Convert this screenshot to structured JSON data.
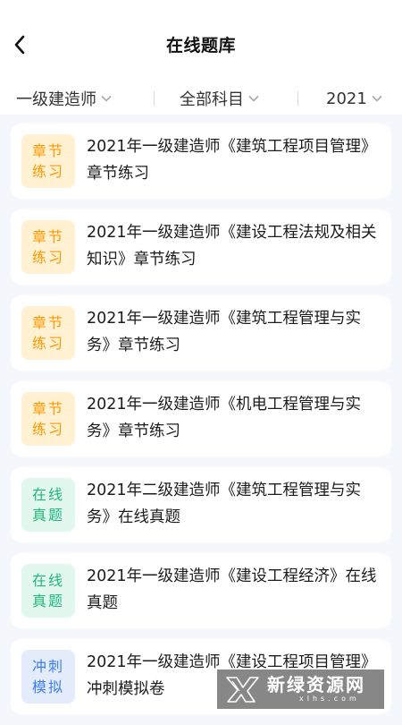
{
  "header": {
    "title": "在线题库"
  },
  "filters": {
    "level": "一级建造师",
    "subject": "全部科目",
    "year": "2021"
  },
  "colors": {
    "chapter": "#ff9700",
    "exam": "#1fb87a",
    "mock": "#3d7ee8"
  },
  "cards": [
    {
      "tag_line1": "章节",
      "tag_line2": "练习",
      "title": "2021年一级建造师《建筑工程项目管理》章节练习"
    },
    {
      "tag_line1": "章节",
      "tag_line2": "练习",
      "title": "2021年一级建造师《建设工程法规及相关知识》章节练习"
    },
    {
      "tag_line1": "章节",
      "tag_line2": "练习",
      "title": "2021年一级建造师《建筑工程管理与实务》章节练习"
    },
    {
      "tag_line1": "章节",
      "tag_line2": "练习",
      "title": "2021年一级建造师《机电工程管理与实务》章节练习"
    },
    {
      "tag_line1": "在线",
      "tag_line2": "真题",
      "title": "2021年二级建造师《建筑工程管理与实务》在线真题"
    },
    {
      "tag_line1": "在线",
      "tag_line2": "真题",
      "title": "2021年一级建造师《建设工程经济》在线真题"
    },
    {
      "tag_line1": "冲刺",
      "tag_line2": "模拟",
      "title": "2021年一级建造师《建设工程项目管理》冲刺模拟卷"
    }
  ],
  "watermark": {
    "main": "新绿资源网",
    "sub": "xlhs.com"
  }
}
